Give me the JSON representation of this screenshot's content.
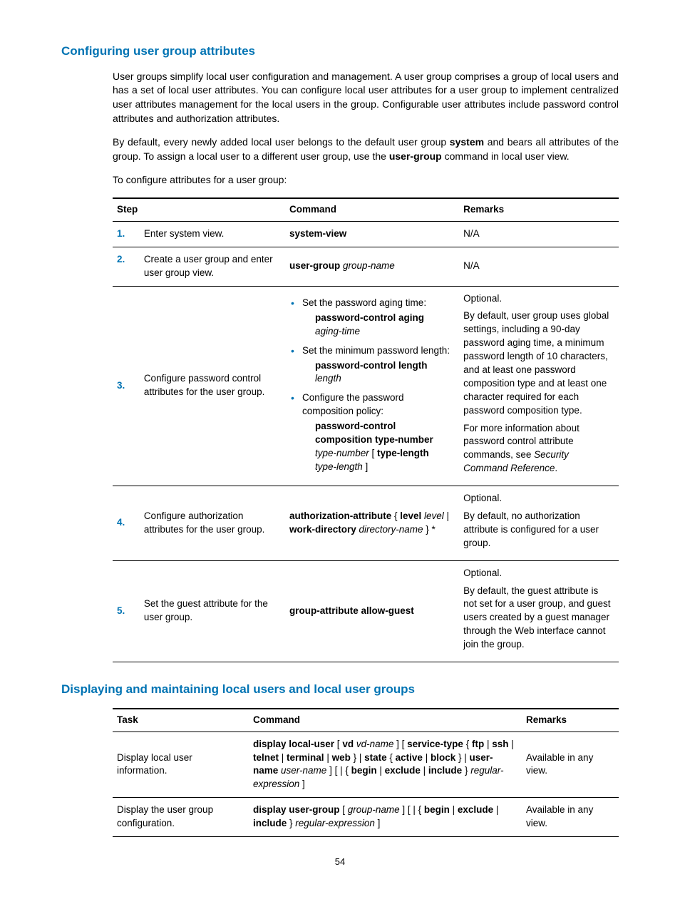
{
  "section1": {
    "title": "Configuring user group attributes",
    "p1": "User groups simplify local user configuration and management. A user group comprises a group of local users and has a set of local user attributes. You can configure local user attributes for a user group to implement centralized user attributes management for the local users in the group. Configurable user attributes include password control attributes and authorization attributes.",
    "p2a": "By default, every newly added local user belongs to the default user group ",
    "p2b": "system",
    "p2c": " and bears all attributes of the group. To assign a local user to a different user group, use the ",
    "p2d": "user-group",
    "p2e": " command in local user view.",
    "p3": "To configure attributes for a user group:"
  },
  "table1": {
    "h1": "Step",
    "h2": "Command",
    "h3": "Remarks",
    "r1n": "1.",
    "r1s": "Enter system view.",
    "r1c": "system-view",
    "r1r": "N/A",
    "r2n": "2.",
    "r2s": "Create a user group and enter user group view.",
    "r2c1": "user-group",
    "r2c2": " group-name",
    "r2r": "N/A",
    "r3n": "3.",
    "r3s": "Configure password control attributes for the user group.",
    "r3b1": "Set the password aging time:",
    "r3b1a": "password-control aging",
    "r3b1b": "aging-time",
    "r3b2": "Set the minimum password length:",
    "r3b2a": "password-control length",
    "r3b2b": " length",
    "r3b3": "Configure the password composition policy:",
    "r3b3a": "password-control composition type-number",
    "r3b3b": " type-number",
    "r3b3c": "type-length",
    "r3b3d": " type-length",
    "r3r1": "Optional.",
    "r3r2": "By default, user group uses global settings, including a 90-day password aging time, a minimum password length of 10 characters, and at least one password composition type and at least one character required for each password composition type.",
    "r3r3a": "For more information about password control attribute commands, see ",
    "r3r3b": "Security Command Reference",
    "r3r3c": ".",
    "r4n": "4.",
    "r4s": "Configure authorization attributes for the user group.",
    "r4c1": "authorization-attribute",
    "r4c2": "level",
    "r4c3": " level",
    "r4c4": "work-directory",
    "r4c5": " directory-name",
    "r4r1": "Optional.",
    "r4r2": "By default, no authorization attribute is configured for a user group.",
    "r5n": "5.",
    "r5s": "Set the guest attribute for the user group.",
    "r5c": "group-attribute allow-guest",
    "r5r1": "Optional.",
    "r5r2": "By default, the guest attribute is not set for a user group, and guest users created by a guest manager through the Web interface cannot join the group."
  },
  "section2": {
    "title": "Displaying and maintaining local users and local user groups"
  },
  "table2": {
    "h1": "Task",
    "h2": "Command",
    "h3": "Remarks",
    "r1t": "Display local user information.",
    "r1_1": "display local-user",
    "r1_2": "vd",
    "r1_3": " vd-name",
    "r1_4": "service-type",
    "r1_5": "ftp",
    "r1_6": "ssh",
    "r1_7": "telnet",
    "r1_8": "terminal",
    "r1_9": "web",
    "r1_10": "state",
    "r1_11": "active",
    "r1_12": "block",
    "r1_13": "user-name",
    "r1_14": " user-name",
    "r1_15": "begin",
    "r1_16": "exclude",
    "r1_17": "include",
    "r1_18": "regular-expression",
    "r1r": "Available in any view.",
    "r2t": "Display the user group configuration.",
    "r2_1": "display user-group",
    "r2_2": " group-name",
    "r2_3": "begin",
    "r2_4": "exclude",
    "r2_5": "include",
    "r2_6": "regular-expression",
    "r2r": "Available in any view."
  },
  "pagenum": "54"
}
